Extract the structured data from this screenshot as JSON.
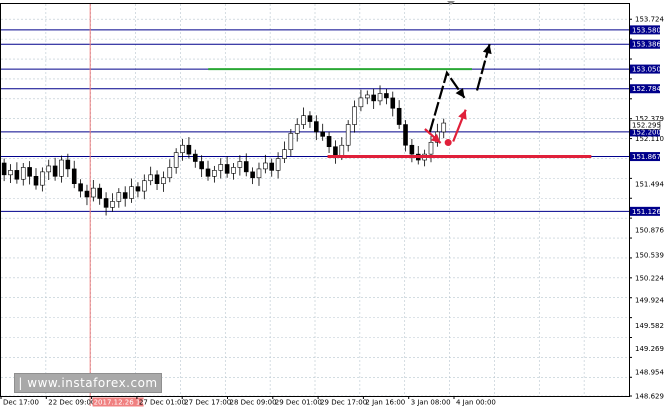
{
  "watermark": "| www.instaforex.com",
  "chart_data": {
    "type": "candlestick",
    "title": "",
    "y_ticks": [
      "153.724",
      "153.455",
      "153.186",
      "152.917",
      "152.648",
      "152.379",
      "152.110",
      "151.841",
      "151.572",
      "151.303",
      "151.034",
      "150.765",
      "150.496",
      "150.227",
      "149.958",
      "149.689",
      "149.420",
      "149.151",
      "148.882",
      "148.629"
    ],
    "visible_tick_labels": [
      "153.724",
      "152.379",
      "152.110",
      "151.494",
      "150.876",
      "150.539",
      "150.224",
      "149.924",
      "149.582",
      "149.269",
      "148.954",
      "148.629"
    ],
    "x_labels": [
      "Dec 17:00",
      "22 Dec 09:00",
      "2017.12.26 14:00",
      "27 Dec 01:00",
      "27 Dec 17:00",
      "28 Dec 09:00",
      "29 Dec 01:00",
      "29 Dec 17:00",
      "2 Jan 16:00",
      "3 Jan 08:00",
      "4 Jan 00:00"
    ],
    "ylim": [
      148.629,
      153.93
    ],
    "levels": [
      {
        "value": 153.58,
        "label": "153.580",
        "color": "#00008b"
      },
      {
        "value": 153.386,
        "label": "153.386",
        "color": "#00008b"
      },
      {
        "value": 153.05,
        "label": "153.050",
        "color": "#00008b"
      },
      {
        "value": 152.784,
        "label": "152.784",
        "color": "#00008b"
      },
      {
        "value": 152.2,
        "label": "152.200",
        "color": "#00008b"
      },
      {
        "value": 151.867,
        "label": "151.867",
        "color": "#00008b"
      },
      {
        "value": 151.126,
        "label": "151.126",
        "color": "#00008b"
      }
    ],
    "current_price": {
      "value": 152.295,
      "label": "152.295"
    },
    "resistance_segment": {
      "value": 153.05,
      "x_from": 0.33,
      "x_to": 0.75,
      "color": "#2aa834"
    },
    "support_segment": {
      "value": 151.867,
      "x_from": 0.52,
      "x_to": 0.94,
      "color": "#e0203a"
    },
    "vertical_marker": {
      "x": 0.142,
      "color": "#f08080"
    },
    "scenario_arrows": [
      {
        "color": "#000000",
        "dashed": true,
        "points": [
          [
            0.683,
            152.2
          ],
          [
            0.71,
            153.0
          ],
          [
            0.738,
            152.66
          ]
        ]
      },
      {
        "color": "#000000",
        "dashed": true,
        "points": [
          [
            0.758,
            152.76
          ],
          [
            0.778,
            153.386
          ]
        ]
      },
      {
        "color": "#e0203a",
        "dashed": true,
        "points": [
          [
            0.675,
            152.24
          ],
          [
            0.7,
            152.05
          ]
        ]
      },
      {
        "color": "#e0203a",
        "dashed": false,
        "points": [
          [
            0.72,
            152.07
          ],
          [
            0.74,
            152.5
          ]
        ]
      }
    ],
    "candles": [
      [
        151.78,
        151.62
      ],
      [
        151.62,
        151.68
      ],
      [
        151.68,
        151.56
      ],
      [
        151.56,
        151.72
      ],
      [
        151.72,
        151.6
      ],
      [
        151.6,
        151.48
      ],
      [
        151.48,
        151.66
      ],
      [
        151.66,
        151.74
      ],
      [
        151.74,
        151.6
      ],
      [
        151.6,
        151.82
      ],
      [
        151.82,
        151.7
      ],
      [
        151.7,
        151.5
      ],
      [
        151.5,
        151.4
      ],
      [
        151.4,
        151.32
      ],
      [
        151.32,
        151.44
      ],
      [
        151.44,
        151.3
      ],
      [
        151.3,
        151.18
      ],
      [
        151.18,
        151.26
      ],
      [
        151.26,
        151.38
      ],
      [
        151.38,
        151.3
      ],
      [
        151.3,
        151.46
      ],
      [
        151.46,
        151.4
      ],
      [
        151.4,
        151.54
      ],
      [
        151.54,
        151.62
      ],
      [
        151.62,
        151.5
      ],
      [
        151.5,
        151.58
      ],
      [
        151.58,
        151.72
      ],
      [
        151.72,
        151.92
      ],
      [
        151.92,
        152.02
      ],
      [
        152.02,
        151.9
      ],
      [
        151.9,
        151.8
      ],
      [
        151.8,
        151.7
      ],
      [
        151.7,
        151.6
      ],
      [
        151.6,
        151.68
      ],
      [
        151.68,
        151.76
      ],
      [
        151.76,
        151.64
      ],
      [
        151.64,
        151.72
      ],
      [
        151.72,
        151.8
      ],
      [
        151.8,
        151.66
      ],
      [
        151.66,
        151.58
      ],
      [
        151.58,
        151.7
      ],
      [
        151.7,
        151.78
      ],
      [
        151.78,
        151.68
      ],
      [
        151.68,
        151.84
      ],
      [
        151.84,
        151.96
      ],
      [
        151.96,
        152.18
      ],
      [
        152.18,
        152.3
      ],
      [
        152.3,
        152.42
      ],
      [
        152.42,
        152.34
      ],
      [
        152.34,
        152.2
      ],
      [
        152.2,
        152.14
      ],
      [
        152.14,
        152.0
      ],
      [
        152.0,
        151.88
      ],
      [
        151.88,
        152.02
      ],
      [
        152.02,
        152.3
      ],
      [
        152.3,
        152.54
      ],
      [
        152.54,
        152.66
      ],
      [
        152.66,
        152.7
      ],
      [
        152.7,
        152.62
      ],
      [
        152.62,
        152.72
      ],
      [
        152.72,
        152.66
      ],
      [
        152.66,
        152.52
      ],
      [
        152.52,
        152.3
      ],
      [
        152.3,
        152.02
      ],
      [
        152.02,
        151.9
      ],
      [
        151.9,
        151.82
      ],
      [
        151.82,
        151.9
      ],
      [
        151.9,
        152.06
      ],
      [
        152.06,
        152.2
      ],
      [
        152.2,
        152.32
      ]
    ]
  }
}
